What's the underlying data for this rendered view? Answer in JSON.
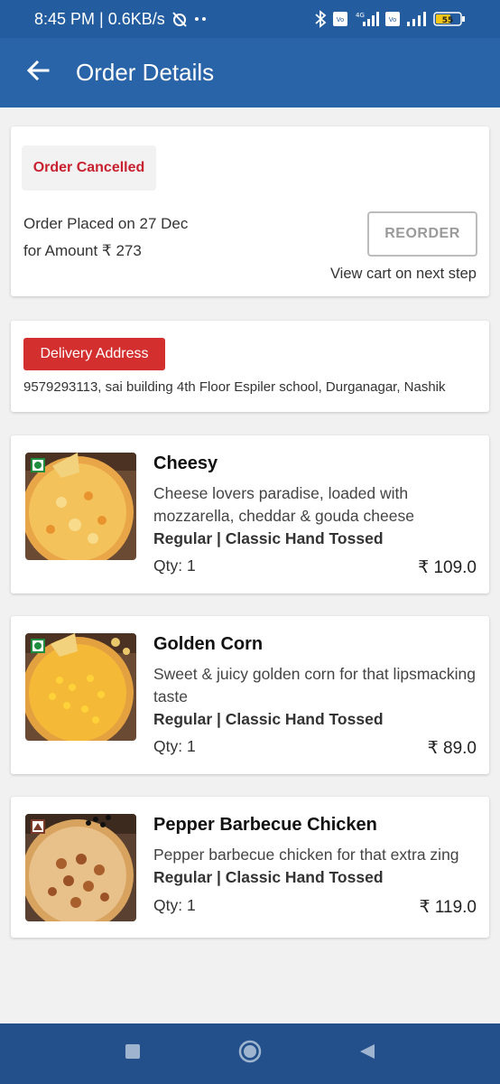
{
  "status_bar": {
    "time_speed": "8:45 PM | 0.6KB/s",
    "network_4g": "4G",
    "volte_1": "Vo LTE",
    "volte_2": "Vo LTE",
    "battery": "55"
  },
  "header": {
    "title": "Order Details"
  },
  "order": {
    "status": "Order Cancelled",
    "placed_on": "Order Placed on 27 Dec",
    "amount": "for Amount ₹ 273",
    "reorder_label": "REORDER",
    "cart_note": "View cart on next step"
  },
  "address": {
    "label": "Delivery Address",
    "text": "9579293113, sai building 4th Floor Espiler school, Durganagar, Nashik"
  },
  "items": [
    {
      "name": "Cheesy",
      "description": "Cheese lovers paradise, loaded with mozzarella, cheddar & gouda cheese",
      "variant": "Regular | Classic Hand Tossed",
      "qty": "Qty: 1",
      "price": "₹ 109.0",
      "type": "veg"
    },
    {
      "name": "Golden Corn",
      "description": "Sweet & juicy golden corn for that lipsmacking taste",
      "variant": "Regular | Classic Hand Tossed",
      "qty": "Qty: 1",
      "price": "₹ 89.0",
      "type": "veg"
    },
    {
      "name": "Pepper Barbecue Chicken",
      "description": "Pepper barbecue chicken for that extra zing",
      "variant": "Regular | Classic Hand Tossed",
      "qty": "Qty: 1",
      "price": "₹ 119.0",
      "type": "non-veg"
    }
  ],
  "colors": {
    "app_bar": "#2a64a8",
    "status_red": "#c8202f",
    "nav_bar": "#23508a"
  }
}
